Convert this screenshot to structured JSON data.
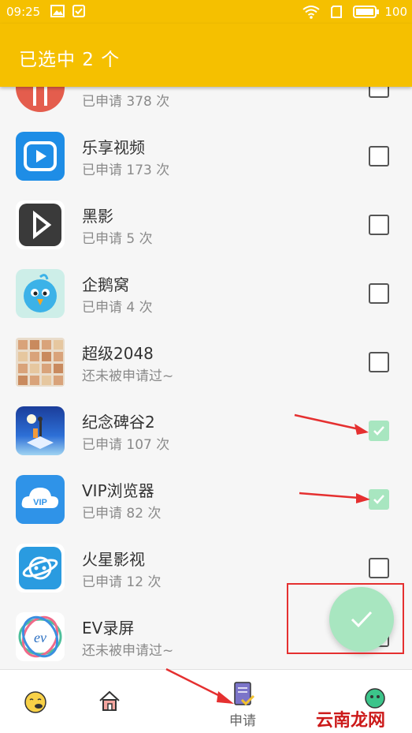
{
  "status_bar": {
    "time": "09:25",
    "battery": "100"
  },
  "appbar": {
    "title": "已选中 2 个"
  },
  "apps": [
    {
      "name": "",
      "sub": "已申请 378 次",
      "icon": "utensils-app-icon",
      "checked": false
    },
    {
      "name": "乐享视频",
      "sub": "已申请 173 次",
      "icon": "play-video-app-icon",
      "checked": false
    },
    {
      "name": "黑影",
      "sub": "已申请 5 次",
      "icon": "play-triangle-app-icon",
      "checked": false
    },
    {
      "name": "企鹅窝",
      "sub": "已申请 4 次",
      "icon": "bird-app-icon",
      "checked": false
    },
    {
      "name": "超级2048",
      "sub": "还未被申请过~",
      "icon": "grid-2048-app-icon",
      "checked": false
    },
    {
      "name": "纪念碑谷2",
      "sub": "已申请 107 次",
      "icon": "monument-valley-app-icon",
      "checked": true
    },
    {
      "name": "VIP浏览器",
      "sub": "已申请 82 次",
      "icon": "vip-cloud-app-icon",
      "checked": true
    },
    {
      "name": "火星影视",
      "sub": "已申请 12 次",
      "icon": "planet-app-icon",
      "checked": false
    },
    {
      "name": "EV录屏",
      "sub": "还未被申请过~",
      "icon": "ev-logo-app-icon",
      "checked": false
    }
  ],
  "bottom_nav": {
    "apply_label": "申请",
    "watermark": "云南龙网"
  },
  "colors": {
    "accent": "#f5c000",
    "check_green": "#a8e6c0",
    "annotation_red": "#e53030"
  }
}
